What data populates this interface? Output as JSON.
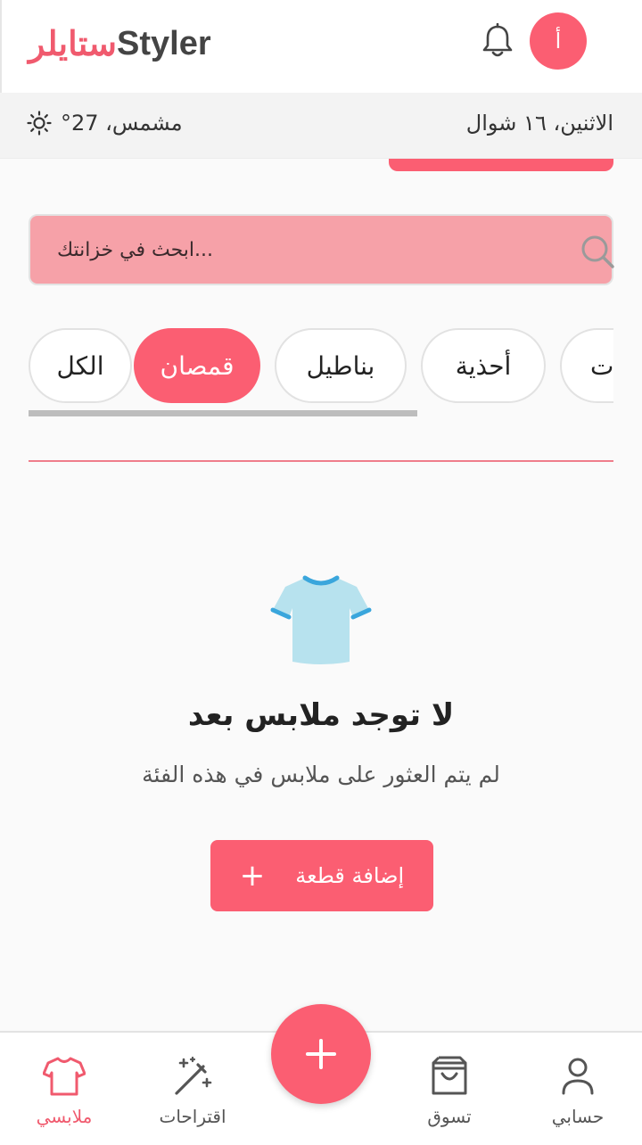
{
  "app": {
    "brand_ar": "ستايلر",
    "brand_en": "Styler",
    "avatar_initial": "أ"
  },
  "weather_bar": {
    "date": "الاثنين، ١٦ شوال",
    "weather": "مشمس، 27°"
  },
  "search": {
    "placeholder": "...ابحث في خزانتك"
  },
  "categories": [
    {
      "label": "الكل",
      "active": false
    },
    {
      "label": "قمصان",
      "active": true
    },
    {
      "label": "بناطيل",
      "active": false
    },
    {
      "label": "أحذية",
      "active": false
    },
    {
      "label": "ت",
      "active": false
    }
  ],
  "empty_state": {
    "title": "لا توجد ملابس بعد",
    "subtitle": "لم يتم العثور على ملابس في هذه الفئة",
    "add_button": "إضافة قطعة",
    "add_icon": "+"
  },
  "bottom_nav": {
    "wardrobe": "ملابسي",
    "suggestions": "اقتراحات",
    "shop": "تسوق",
    "account": "حسابي"
  },
  "icons": {
    "bell": "bell-icon",
    "sun": "sun-icon",
    "search": "search-icon",
    "tshirt": "tshirt-icon",
    "magic": "magic-wand-icon",
    "bag": "shopping-bag-icon",
    "person": "person-icon",
    "plus": "plus-icon"
  },
  "colors": {
    "accent": "#fb5e72",
    "search_bg": "#f6a1a8",
    "tshirt": "#b7e2ee",
    "tshirt_trim": "#3aa6dc"
  }
}
